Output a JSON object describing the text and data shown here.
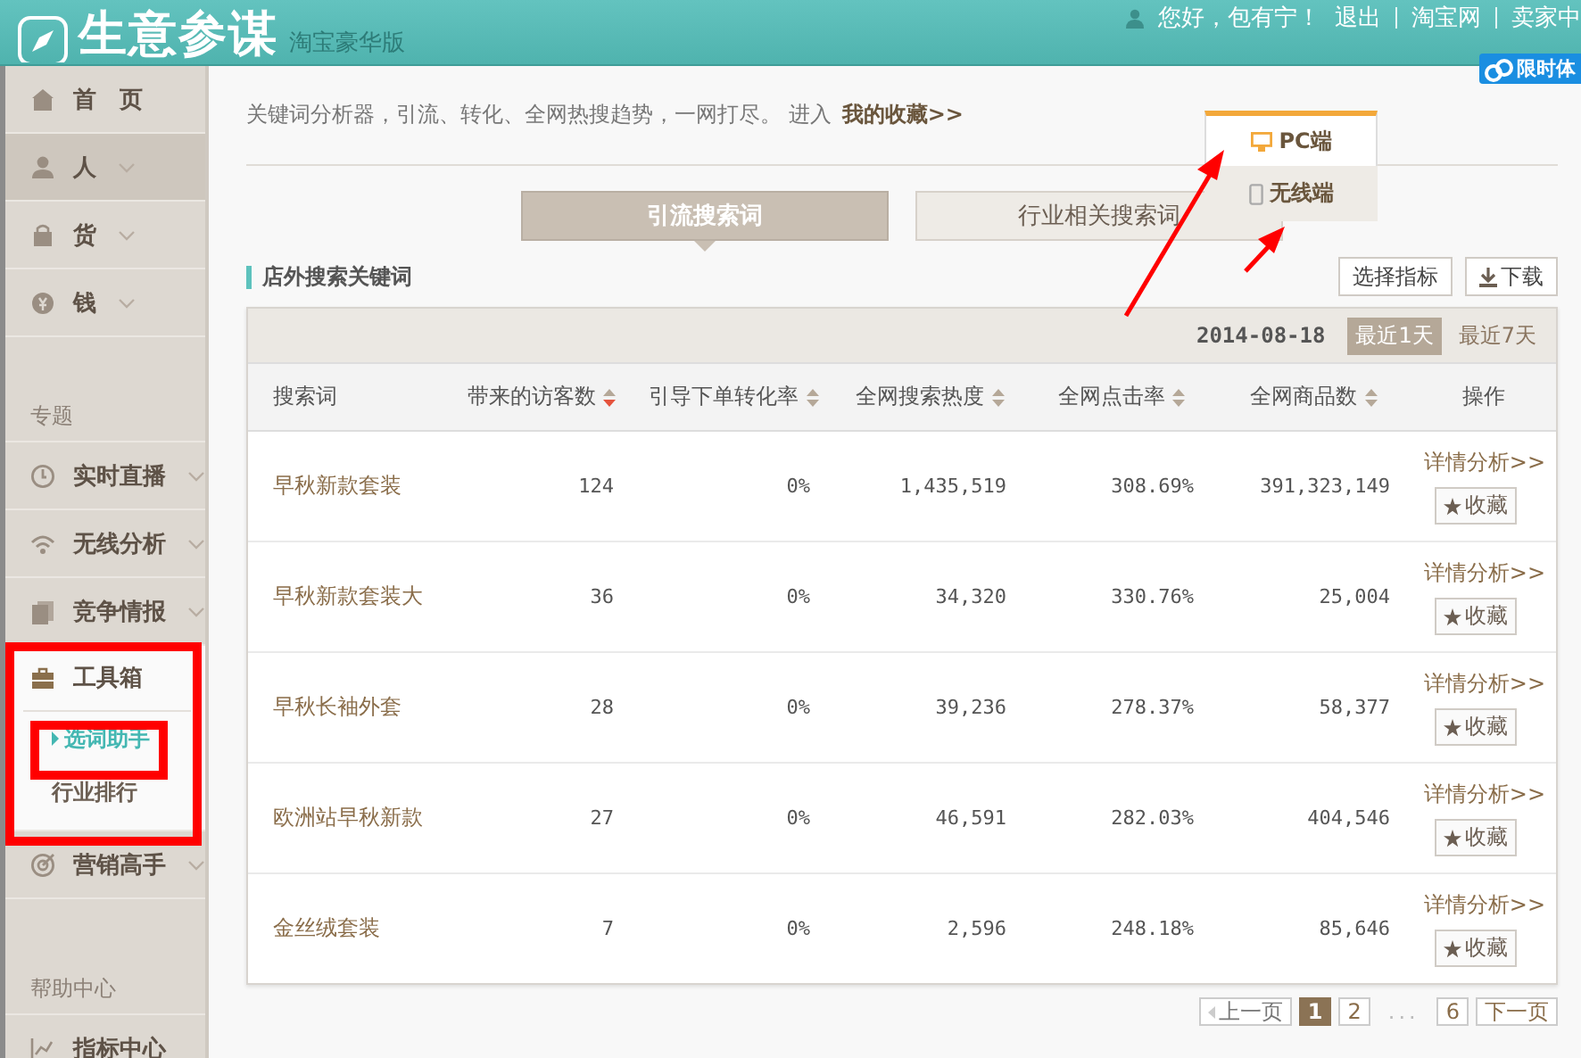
{
  "header": {
    "title": "生意参谋",
    "edition": "淘宝豪华版",
    "greeting": "您好，包有宁！",
    "links": [
      "退出",
      "淘宝网",
      "卖家中"
    ],
    "badge": "限时体"
  },
  "sidebar": {
    "entries": [
      {
        "kind": "item",
        "label": "首　页",
        "has_menu": false,
        "selected": false
      },
      {
        "kind": "item",
        "label": "人",
        "has_menu": true,
        "selected": true
      },
      {
        "kind": "item",
        "label": "货",
        "has_menu": true,
        "selected": false
      },
      {
        "kind": "item",
        "label": "钱",
        "has_menu": true,
        "selected": false
      },
      {
        "kind": "heading",
        "label": "专题"
      },
      {
        "kind": "item",
        "label": "实时直播",
        "has_menu": true,
        "selected": false
      },
      {
        "kind": "item",
        "label": "无线分析",
        "has_menu": true,
        "selected": false
      },
      {
        "kind": "item",
        "label": "竞争情报",
        "has_menu": true,
        "selected": false
      },
      {
        "kind": "group",
        "label": "工具箱",
        "expanded": true,
        "children": [
          {
            "label": "选词助手",
            "selected": true
          },
          {
            "label": "行业排行",
            "selected": false
          }
        ]
      },
      {
        "kind": "item",
        "label": "营销高手",
        "has_menu": true,
        "selected": false
      },
      {
        "kind": "heading",
        "label": "帮助中心"
      },
      {
        "kind": "item",
        "label": "指标中心",
        "has_menu": false,
        "selected": false
      }
    ]
  },
  "main": {
    "intro": {
      "text": "关键词分析器，引流、转化、全网热搜趋势，一网打尽。 进入",
      "link": "我的收藏>>"
    },
    "device_tabs": [
      {
        "label": "PC端",
        "selected": true
      },
      {
        "label": "无线端",
        "selected": false
      }
    ],
    "tabs": [
      {
        "label": "引流搜索词",
        "selected": true
      },
      {
        "label": "行业相关搜索词",
        "selected": false
      }
    ],
    "section_title": "店外搜索关键词",
    "buttons": [
      {
        "kind": "plain",
        "label": "选择指标"
      },
      {
        "kind": "download",
        "label": "下载"
      }
    ],
    "table": {
      "date": "2014-08-18",
      "ranges": [
        {
          "label": "最近1天",
          "selected": true
        },
        {
          "label": "最近7天",
          "selected": false
        }
      ],
      "columns": [
        {
          "label": "搜索词",
          "sortable": false
        },
        {
          "label": "带来的访客数",
          "sortable": true,
          "sorted": true
        },
        {
          "label": "引导下单转化率",
          "sortable": true,
          "sorted": false
        },
        {
          "label": "全网搜索热度",
          "sortable": true,
          "sorted": false
        },
        {
          "label": "全网点击率",
          "sortable": true,
          "sorted": false
        },
        {
          "label": "全网商品数",
          "sortable": true,
          "sorted": false
        },
        {
          "label": "操作",
          "sortable": false
        }
      ],
      "rows": [
        {
          "cells": [
            "早秋新款套装",
            "124",
            "0%",
            "1,435,519",
            "308.69%",
            "391,323,149"
          ],
          "detail": "详情分析>>",
          "favorite": "收藏"
        },
        {
          "cells": [
            "早秋新款套装大",
            "36",
            "0%",
            "34,320",
            "330.76%",
            "25,004"
          ],
          "detail": "详情分析>>",
          "favorite": "收藏"
        },
        {
          "cells": [
            "早秋长袖外套",
            "28",
            "0%",
            "39,236",
            "278.37%",
            "58,377"
          ],
          "detail": "详情分析>>",
          "favorite": "收藏"
        },
        {
          "cells": [
            "欧洲站早秋新款",
            "27",
            "0%",
            "46,591",
            "282.03%",
            "404,546"
          ],
          "detail": "详情分析>>",
          "favorite": "收藏"
        },
        {
          "cells": [
            "金丝绒套装",
            "7",
            "0%",
            "2,596",
            "248.18%",
            "85,646"
          ],
          "detail": "详情分析>>",
          "favorite": "收藏"
        }
      ]
    },
    "pagination": {
      "prev": {
        "label": "上一页",
        "disabled": true
      },
      "pages": [
        {
          "kind": "page",
          "label": "1",
          "selected": true
        },
        {
          "kind": "page",
          "label": "2",
          "selected": false
        },
        {
          "kind": "gap",
          "label": "..."
        },
        {
          "kind": "page",
          "label": "6",
          "selected": false
        }
      ],
      "next": "下一页"
    }
  }
}
